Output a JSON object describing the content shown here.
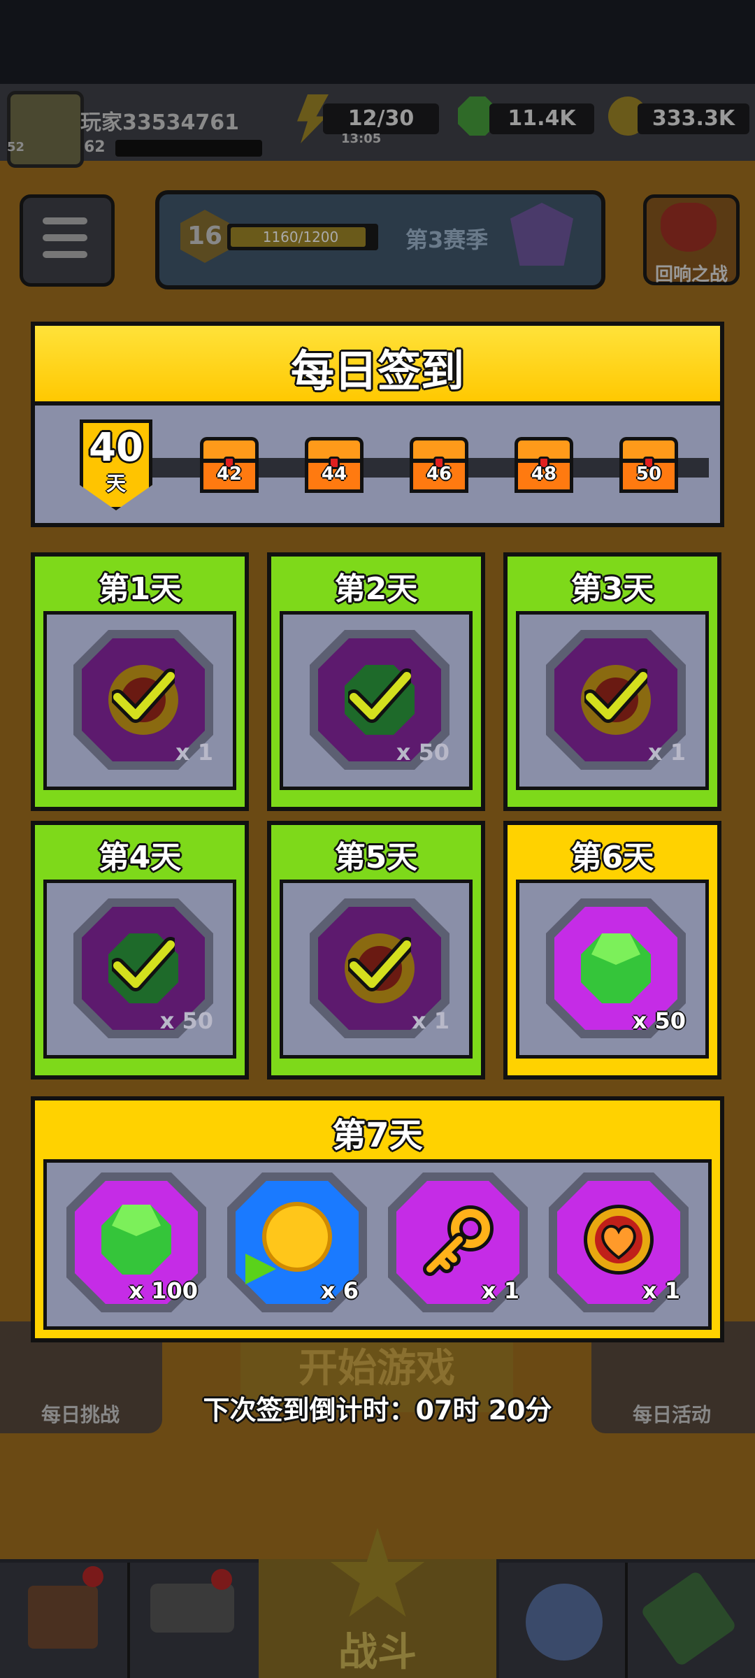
{
  "player": {
    "name": "玩家33534761",
    "level": "62",
    "avatar_level": "52"
  },
  "resources": {
    "energy": "12/30",
    "energy_timer": "13:05",
    "gems": "11.4K",
    "coins": "333.3K"
  },
  "season": {
    "level": "16",
    "progress_text": "1160/1200",
    "progress": 0.967,
    "name": "第3赛季"
  },
  "buttons": {
    "echo_battle": "回响之战",
    "daily_challenge": "每日挑战",
    "daily_event": "每日活动",
    "start_game": "开始游戏"
  },
  "nav": {
    "battle": "战斗"
  },
  "popup": {
    "title": "每日签到",
    "streak_days": "40",
    "streak_unit": "天",
    "milestones": [
      "42",
      "44",
      "46",
      "48",
      "50"
    ],
    "days": [
      {
        "title": "第1天",
        "reward": "medal",
        "count": "x 1",
        "claimed": true
      },
      {
        "title": "第2天",
        "reward": "gem",
        "count": "x 50",
        "claimed": true
      },
      {
        "title": "第3天",
        "reward": "medal",
        "count": "x 1",
        "claimed": true
      },
      {
        "title": "第4天",
        "reward": "gem",
        "count": "x 50",
        "claimed": true
      },
      {
        "title": "第5天",
        "reward": "medal",
        "count": "x 1",
        "claimed": true
      },
      {
        "title": "第6天",
        "reward": "gem",
        "count": "x 50",
        "claimed": false
      }
    ],
    "day7": {
      "title": "第7天",
      "rewards": [
        {
          "icon": "gem-icon",
          "count": "x 100"
        },
        {
          "icon": "coin-icon",
          "count": "x 6"
        },
        {
          "icon": "key-icon",
          "count": "x 1"
        },
        {
          "icon": "heart-medal-icon",
          "count": "x 1"
        }
      ]
    },
    "countdown": "下次签到倒计时：07时 20分"
  },
  "colors": {
    "header_yellow": "#ffd200",
    "claimed_green": "#7ed91a",
    "panel_gray": "#8a8fa8",
    "gem_green": "#35c53a",
    "item_purple": "#c52ce6"
  }
}
